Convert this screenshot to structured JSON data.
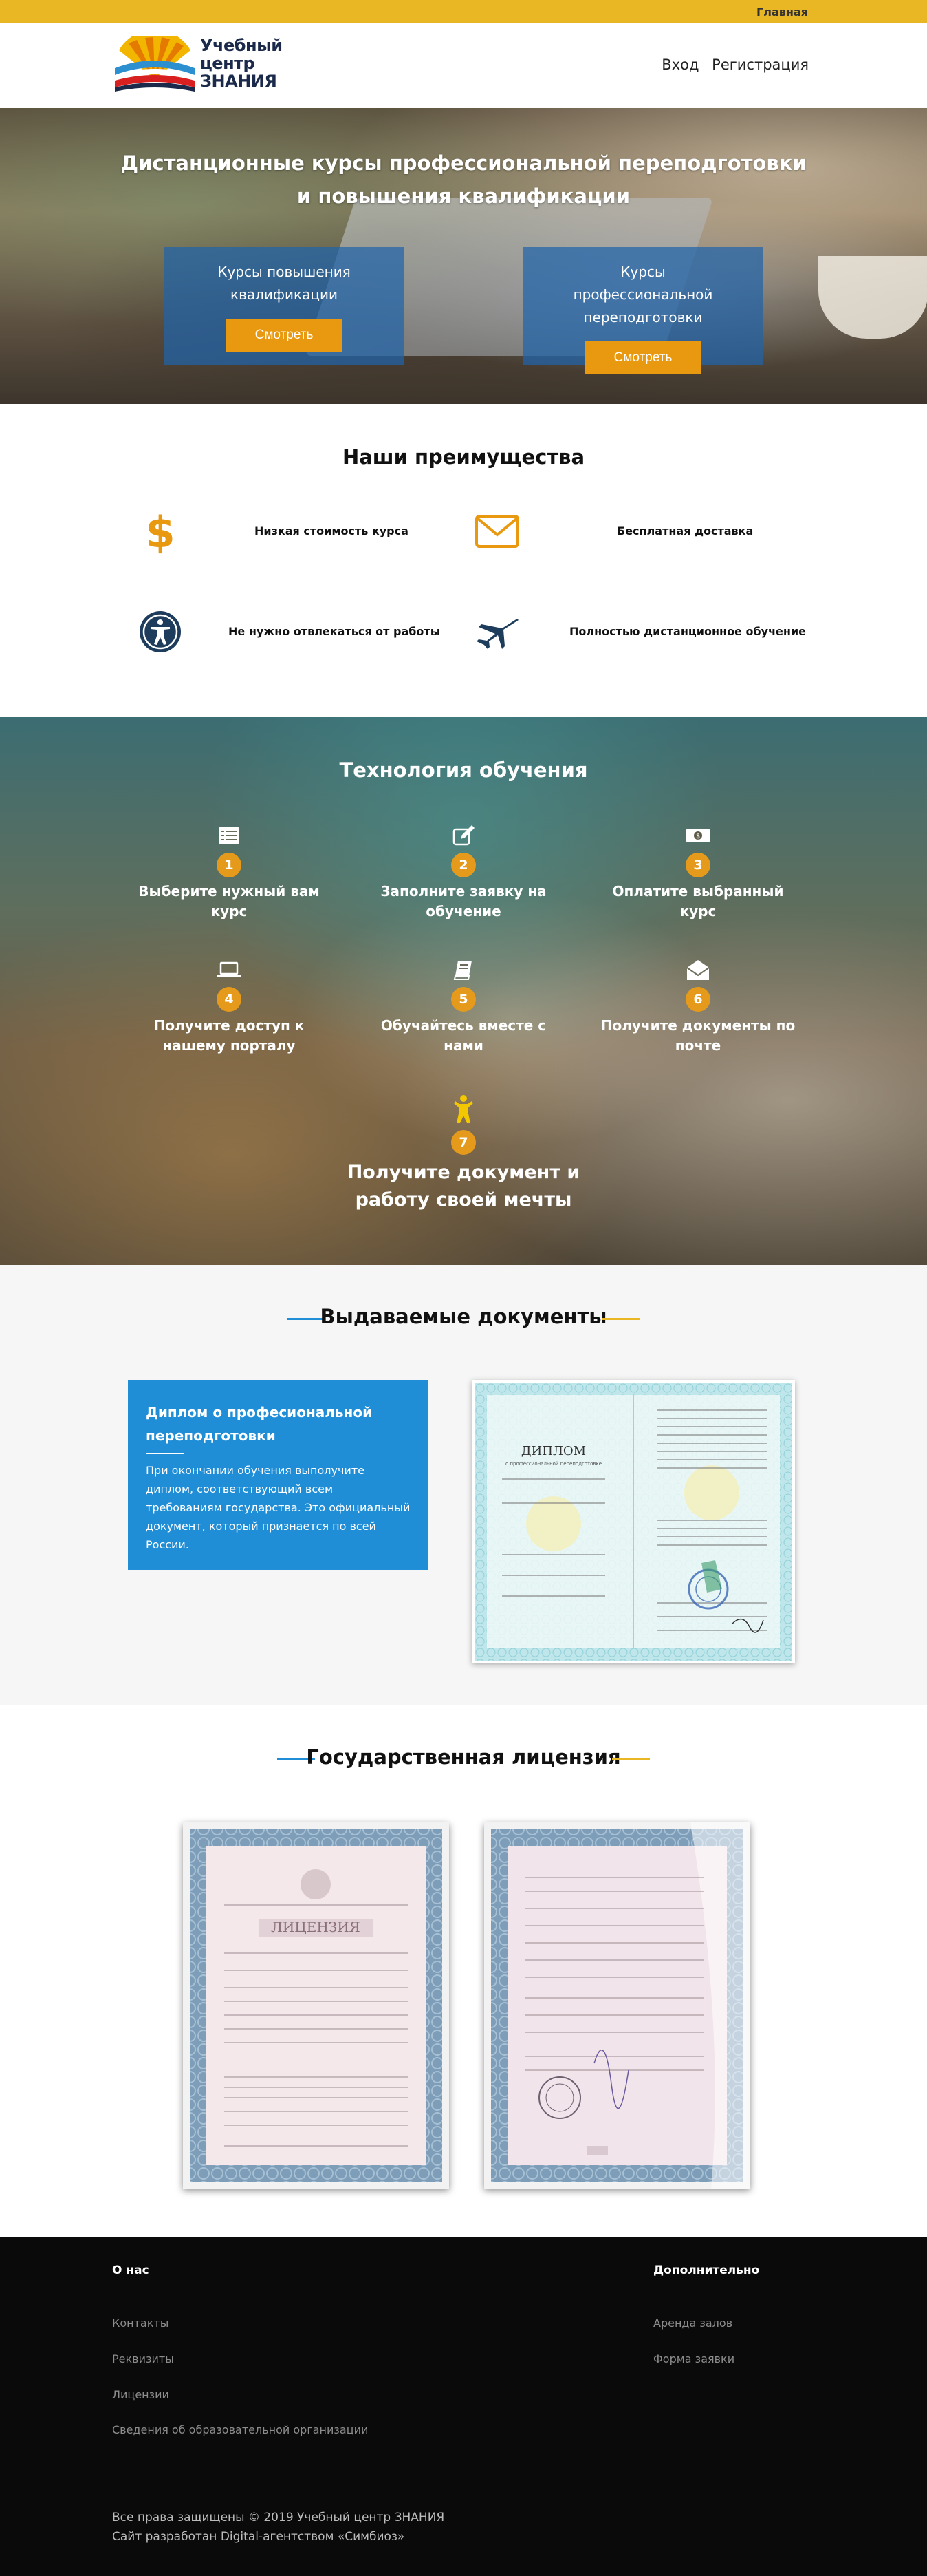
{
  "topbar": {
    "home_link": "Главная"
  },
  "header": {
    "logo_lines": [
      "Учебный",
      "центр",
      "ЗНАНИЯ"
    ],
    "nav": {
      "login": "Вход",
      "register": "Регистрация"
    }
  },
  "hero": {
    "title": "Дистанционные курсы профессиональной переподготовки и повышения квалификации",
    "cards": [
      {
        "title": "Курсы повышения квалификации",
        "button": "Смотреть"
      },
      {
        "title": "Курсы профессиональной переподготовки",
        "button": "Смотреть"
      }
    ]
  },
  "advantages": {
    "title": "Наши преимущества",
    "items": [
      {
        "icon": "dollar-icon",
        "text": "Низкая стоимость курса"
      },
      {
        "icon": "envelope-icon",
        "text": "Бесплатная доставка"
      },
      {
        "icon": "accessibility-icon",
        "text": "Не нужно отвлекаться от работы"
      },
      {
        "icon": "plane-icon",
        "text": "Полностью дистанционное обучение"
      }
    ]
  },
  "technology": {
    "title": "Технология обучения",
    "steps": [
      {
        "num": "1",
        "icon": "list-icon",
        "text": "Выберите нужный вам курс"
      },
      {
        "num": "2",
        "icon": "edit-icon",
        "text": "Заполните заявку на обучение"
      },
      {
        "num": "3",
        "icon": "money-icon",
        "text": "Оплатите выбранный курс"
      },
      {
        "num": "4",
        "icon": "laptop-icon",
        "text": "Получите доступ к нашему порталу"
      },
      {
        "num": "5",
        "icon": "book-icon",
        "text": "Обучайтесь вместе с нами"
      },
      {
        "num": "6",
        "icon": "envelope-open-icon",
        "text": "Получите документы по почте"
      },
      {
        "num": "7",
        "icon": "child-icon",
        "text": "Получите документ и работу своей мечты"
      }
    ]
  },
  "documents": {
    "title": "Выдаваемые документы",
    "card_title": "Диплом о професиональной переподготовки",
    "card_text": "При окончании обучения выполучите диплом, соответствующий всем требованиям государства. Это официальный документ, который признается по всей России.",
    "diploma": {
      "header": "ДИПЛОМ",
      "sub": "о профессиональной переподготовке"
    }
  },
  "license": {
    "title": "Государственная лицензия",
    "front_word": "ЛИЦЕНЗИЯ"
  },
  "footer": {
    "about_title": "О нас",
    "about_links": [
      "Контакты",
      "Реквизиты",
      "Лицензии",
      "Сведения об образовательной организации"
    ],
    "extra_title": "Дополнительно",
    "extra_links": [
      "Аренда залов",
      "Форма заявки"
    ],
    "copyright": "Все права защищены © 2019 Учебный центр ЗНАНИЯ",
    "developer": "Сайт разработан Digital-агентством «Симбиоз»"
  },
  "colors": {
    "brand_yellow": "#e9b624",
    "orange": "#e8990f",
    "blue": "#1f8ed7",
    "navy": "#1e3d5c"
  }
}
